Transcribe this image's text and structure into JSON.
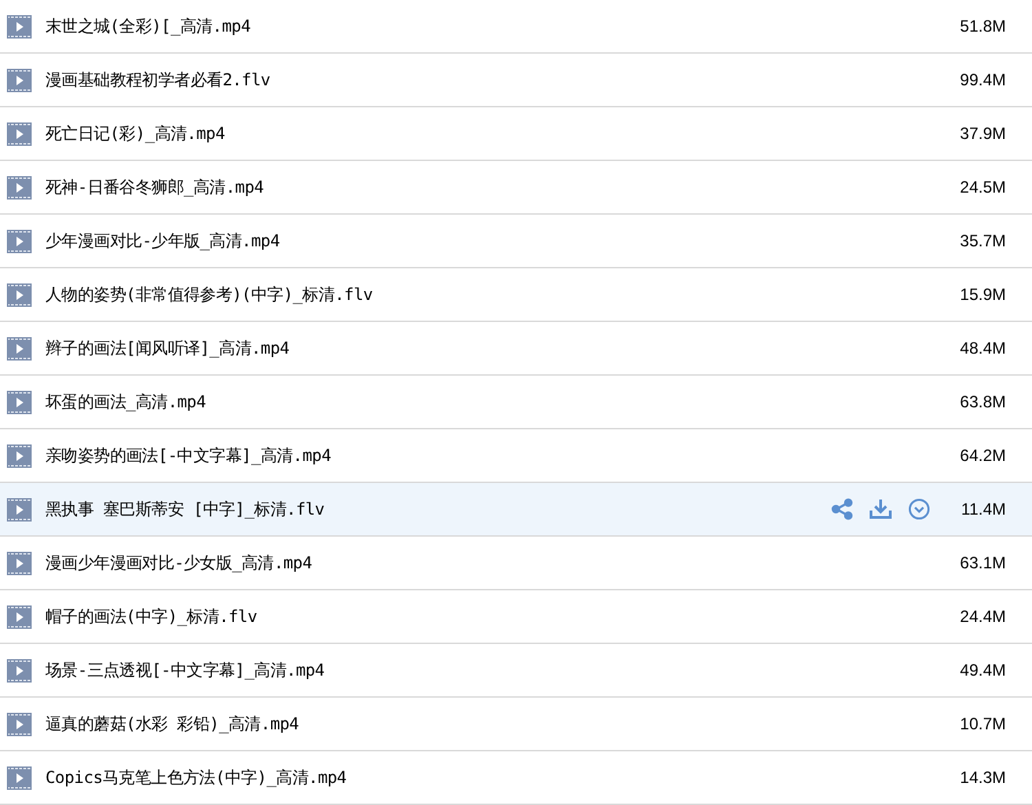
{
  "files": [
    {
      "name": "末世之城(全彩)[_高清.mp4",
      "size": "51.8M",
      "hovered": false
    },
    {
      "name": "漫画基础教程初学者必看2.flv",
      "size": "99.4M",
      "hovered": false
    },
    {
      "name": "死亡日记(彩)_高清.mp4",
      "size": "37.9M",
      "hovered": false
    },
    {
      "name": "死神-日番谷冬狮郎_高清.mp4",
      "size": "24.5M",
      "hovered": false
    },
    {
      "name": "少年漫画对比-少年版_高清.mp4",
      "size": "35.7M",
      "hovered": false
    },
    {
      "name": "人物的姿势(非常值得参考)(中字)_标清.flv",
      "size": "15.9M",
      "hovered": false
    },
    {
      "name": "辫子的画法[闻风听译]_高清.mp4",
      "size": "48.4M",
      "hovered": false
    },
    {
      "name": "坏蛋的画法_高清.mp4",
      "size": "63.8M",
      "hovered": false
    },
    {
      "name": "亲吻姿势的画法[-中文字幕]_高清.mp4",
      "size": "64.2M",
      "hovered": false
    },
    {
      "name": "黑执事 塞巴斯蒂安 [中字]_标清.flv",
      "size": "11.4M",
      "hovered": true
    },
    {
      "name": "漫画少年漫画对比-少女版_高清.mp4",
      "size": "63.1M",
      "hovered": false
    },
    {
      "name": "帽子的画法(中字)_标清.flv",
      "size": "24.4M",
      "hovered": false
    },
    {
      "name": "场景-三点透视[-中文字幕]_高清.mp4",
      "size": "49.4M",
      "hovered": false
    },
    {
      "name": "逼真的蘑菇(水彩 彩铅)_高清.mp4",
      "size": "10.7M",
      "hovered": false
    },
    {
      "name": "Copics马克笔上色方法(中字)_高清.mp4",
      "size": "14.3M",
      "hovered": false
    }
  ]
}
